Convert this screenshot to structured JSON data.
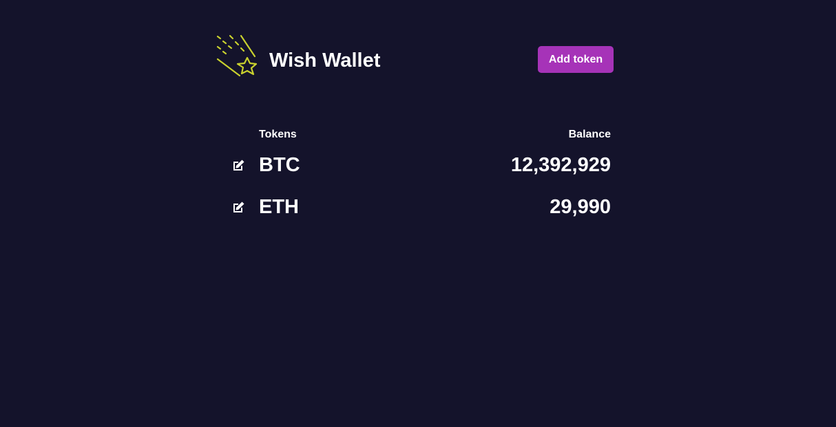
{
  "app": {
    "title": "Wish Wallet",
    "logo_icon": "shooting-star-icon",
    "accent_color": "#a633b8",
    "logo_color": "#c9d12e",
    "background_color": "#14132b"
  },
  "header": {
    "add_token_label": "Add token"
  },
  "table": {
    "columns": {
      "tokens": "Tokens",
      "balance": "Balance"
    },
    "rows": [
      {
        "token": "BTC",
        "balance": "12,392,929",
        "edit_icon": "edit-icon"
      },
      {
        "token": "ETH",
        "balance": "29,990",
        "edit_icon": "edit-icon"
      }
    ]
  }
}
